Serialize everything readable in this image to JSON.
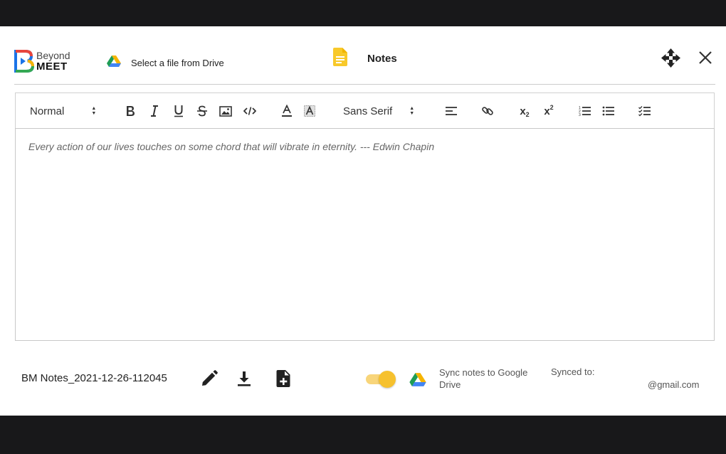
{
  "app": {
    "logo_line1": "Beyond",
    "logo_line2": "MEET"
  },
  "header": {
    "drive_select_label": "Select a file from Drive",
    "title": "Notes"
  },
  "toolbar": {
    "heading_select": "Normal",
    "font_select": "Sans Serif",
    "subscript": "x",
    "subscript_mark": "2",
    "superscript": "x",
    "superscript_mark": "2"
  },
  "editor": {
    "placeholder": "Every action of our lives touches on some chord that will vibrate in eternity. --- Edwin Chapin"
  },
  "footer": {
    "filename": "BM Notes_2021-12-26-112045",
    "sync_label": "Sync notes to Google Drive",
    "synced_to_label": "Synced to:",
    "email": "@gmail.com",
    "sync_enabled": true
  },
  "colors": {
    "toggle_on": "#f6c12e",
    "notes_icon": "#f8c92a",
    "backdrop": "#18181a"
  }
}
